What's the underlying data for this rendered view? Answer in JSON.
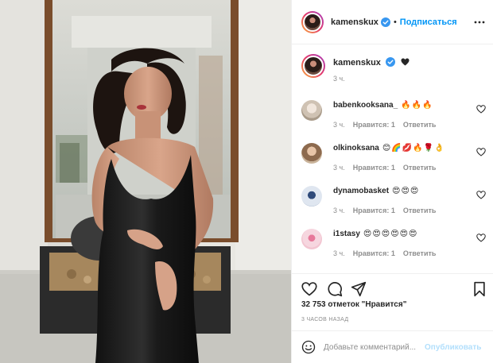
{
  "post": {
    "author": "kamenskux",
    "follow_label": "Подписаться",
    "separator": "•",
    "caption_emoji": "🖤",
    "caption_time": "3 ч.",
    "likes_text": "32 753 отметок \"Нравится\"",
    "time_ago": "3 часов назад"
  },
  "comments": [
    {
      "user": "babenkooksana_",
      "text": "🔥🔥🔥",
      "time": "3 ч.",
      "likes": "Нравится: 1",
      "reply": "Ответить"
    },
    {
      "user": "olkinoksana",
      "text": "😊🌈💋🔥🌹👌",
      "time": "3 ч.",
      "likes": "Нравится: 1",
      "reply": "Ответить"
    },
    {
      "user": "dynamobasket",
      "text": "😍😍😍",
      "time": "3 ч.",
      "likes": "Нравится: 1",
      "reply": "Ответить"
    },
    {
      "user": "i1stasy",
      "text": "😍😍😍😍😍😍",
      "time": "3 ч.",
      "likes": "Нравится: 1",
      "reply": "Ответить"
    }
  ],
  "add_comment": {
    "placeholder": "Добавьте комментарий...",
    "publish_label": "Опубликовать"
  },
  "colors": {
    "accent": "#0095f6",
    "publish_disabled": "#b2dffc",
    "secondary_text": "#8e8e8e",
    "verified": "#3897f0"
  },
  "icons": [
    "verified-icon",
    "more-options-icon",
    "heart-icon",
    "comment-icon",
    "share-icon",
    "bookmark-icon",
    "smile-icon"
  ]
}
